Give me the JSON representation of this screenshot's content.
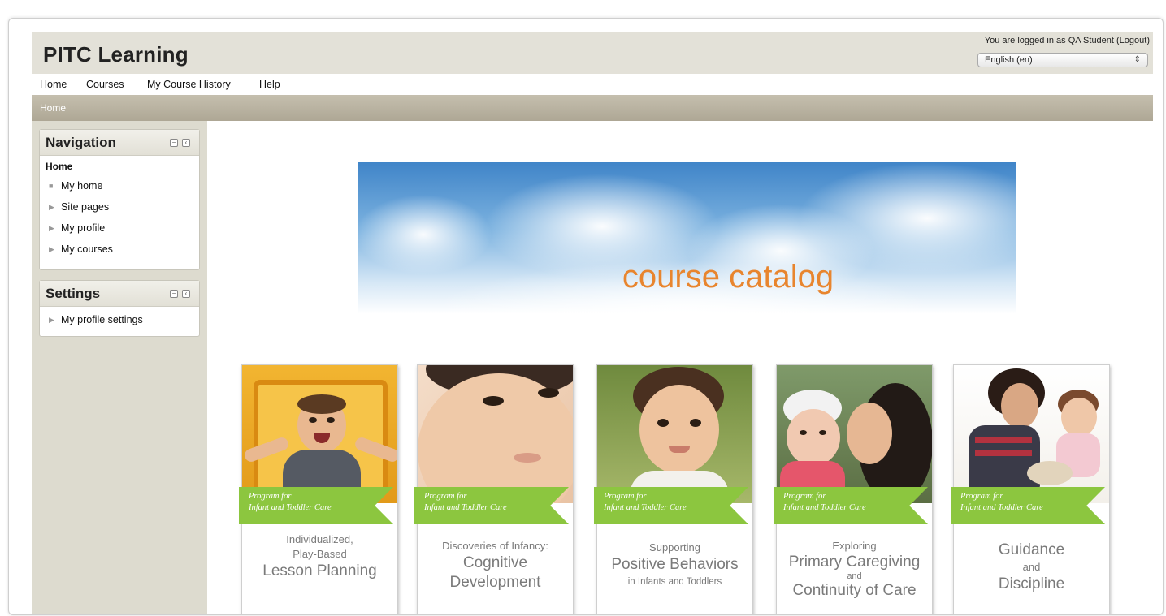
{
  "header": {
    "site_title": "PITC Learning",
    "login_text": "You are logged in as QA Student (Logout)",
    "language_selected": "English (en)"
  },
  "menu": {
    "items": [
      "Home",
      "Courses",
      "My Course History",
      "Help"
    ]
  },
  "breadcrumb": {
    "current": "Home"
  },
  "sidebar": {
    "navigation": {
      "title": "Navigation",
      "home_label": "Home",
      "items": [
        "My home",
        "Site pages",
        "My profile",
        "My courses"
      ]
    },
    "settings": {
      "title": "Settings",
      "items": [
        "My profile settings"
      ]
    }
  },
  "main": {
    "banner_text": "course catalog",
    "ribbon_line1": "Program for",
    "ribbon_line2": "Infant and Toddler Care",
    "courses": [
      {
        "line1": "Individualized,",
        "line2": "Play-Based",
        "line3": "Lesson Planning"
      },
      {
        "line1": "Discoveries of Infancy:",
        "line2": "Cognitive",
        "line3": "Development"
      },
      {
        "line1": "Supporting",
        "line2": "Positive Behaviors",
        "line3": "in Infants and Toddlers"
      },
      {
        "line1": "Exploring",
        "line2": "Primary Caregiving",
        "line3": "and",
        "line4": "Continuity of Care"
      },
      {
        "line1": "Guidance",
        "line2": "and",
        "line3": "Discipline"
      }
    ]
  },
  "colors": {
    "header_bg": "#e3e1d8",
    "breadcrumb_bg": "#aea795",
    "sidebar_bg": "#dddbcf",
    "banner_text": "#e8852e",
    "ribbon_green": "#8cc63f"
  }
}
